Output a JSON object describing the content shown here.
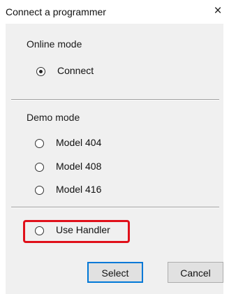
{
  "window": {
    "title": "Connect a programmer",
    "close_glyph": "×"
  },
  "online": {
    "label": "Online mode",
    "options": [
      {
        "label": "Connect",
        "checked": true
      }
    ]
  },
  "demo": {
    "label": "Demo mode",
    "options": [
      {
        "label": "Model 404",
        "checked": false
      },
      {
        "label": "Model 408",
        "checked": false
      },
      {
        "label": "Model 416",
        "checked": false
      }
    ]
  },
  "handler": {
    "label": "Use Handler",
    "checked": false,
    "highlight_color": "#e0101a"
  },
  "buttons": {
    "select_label": "Select",
    "cancel_label": "Cancel"
  }
}
